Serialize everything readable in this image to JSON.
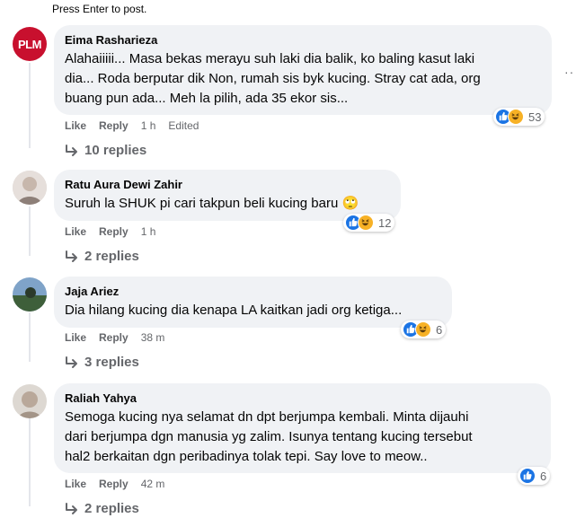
{
  "hint": "Press Enter to post.",
  "options_glyph": "···",
  "comments": [
    {
      "author": "Eima Rasharieza",
      "avatar_text": "PLM",
      "text": "Alahaiiiii... Masa bekas merayu suh laki dia balik, ko baling kasut laki\ndia... Roda berputar dik Non, rumah sis byk kucing. Stray cat ada, org\nbuang pun ada... Meh la pilih, ada 35 ekor sis...",
      "like": "Like",
      "reply": "Reply",
      "time": "1 h",
      "edited": "Edited",
      "reactions": "53",
      "replies": "10 replies"
    },
    {
      "author": "Ratu Aura Dewi Zahir",
      "text": "Suruh la SHUK pi cari takpun beli kucing baru 🙄",
      "like": "Like",
      "reply": "Reply",
      "time": "1 h",
      "reactions": "12",
      "replies": "2 replies"
    },
    {
      "author": "Jaja Ariez",
      "text": "Dia hilang kucing dia kenapa LA kaitkan jadi org ketiga...",
      "like": "Like",
      "reply": "Reply",
      "time": "38 m",
      "reactions": "6",
      "replies": "3 replies"
    },
    {
      "author": "Raliah Yahya",
      "text": "Semoga kucing nya selamat dn dpt berjumpa kembali. Minta dijauhi\ndari berjumpa dgn manusia yg zalim. Isunya tentang kucing tersebut\nhal2 berkaitan dgn peribadinya tolak tepi. Say love to meow..",
      "like": "Like",
      "reply": "Reply",
      "time": "42 m",
      "reactions": "6",
      "replies": "2 replies"
    }
  ],
  "colors": {
    "bubble": "#f0f2f5",
    "secondary_text": "#65676b",
    "like_blue": "#1b74e4",
    "haha_yellow": "#f7b125",
    "plm_red": "#c8102e"
  }
}
